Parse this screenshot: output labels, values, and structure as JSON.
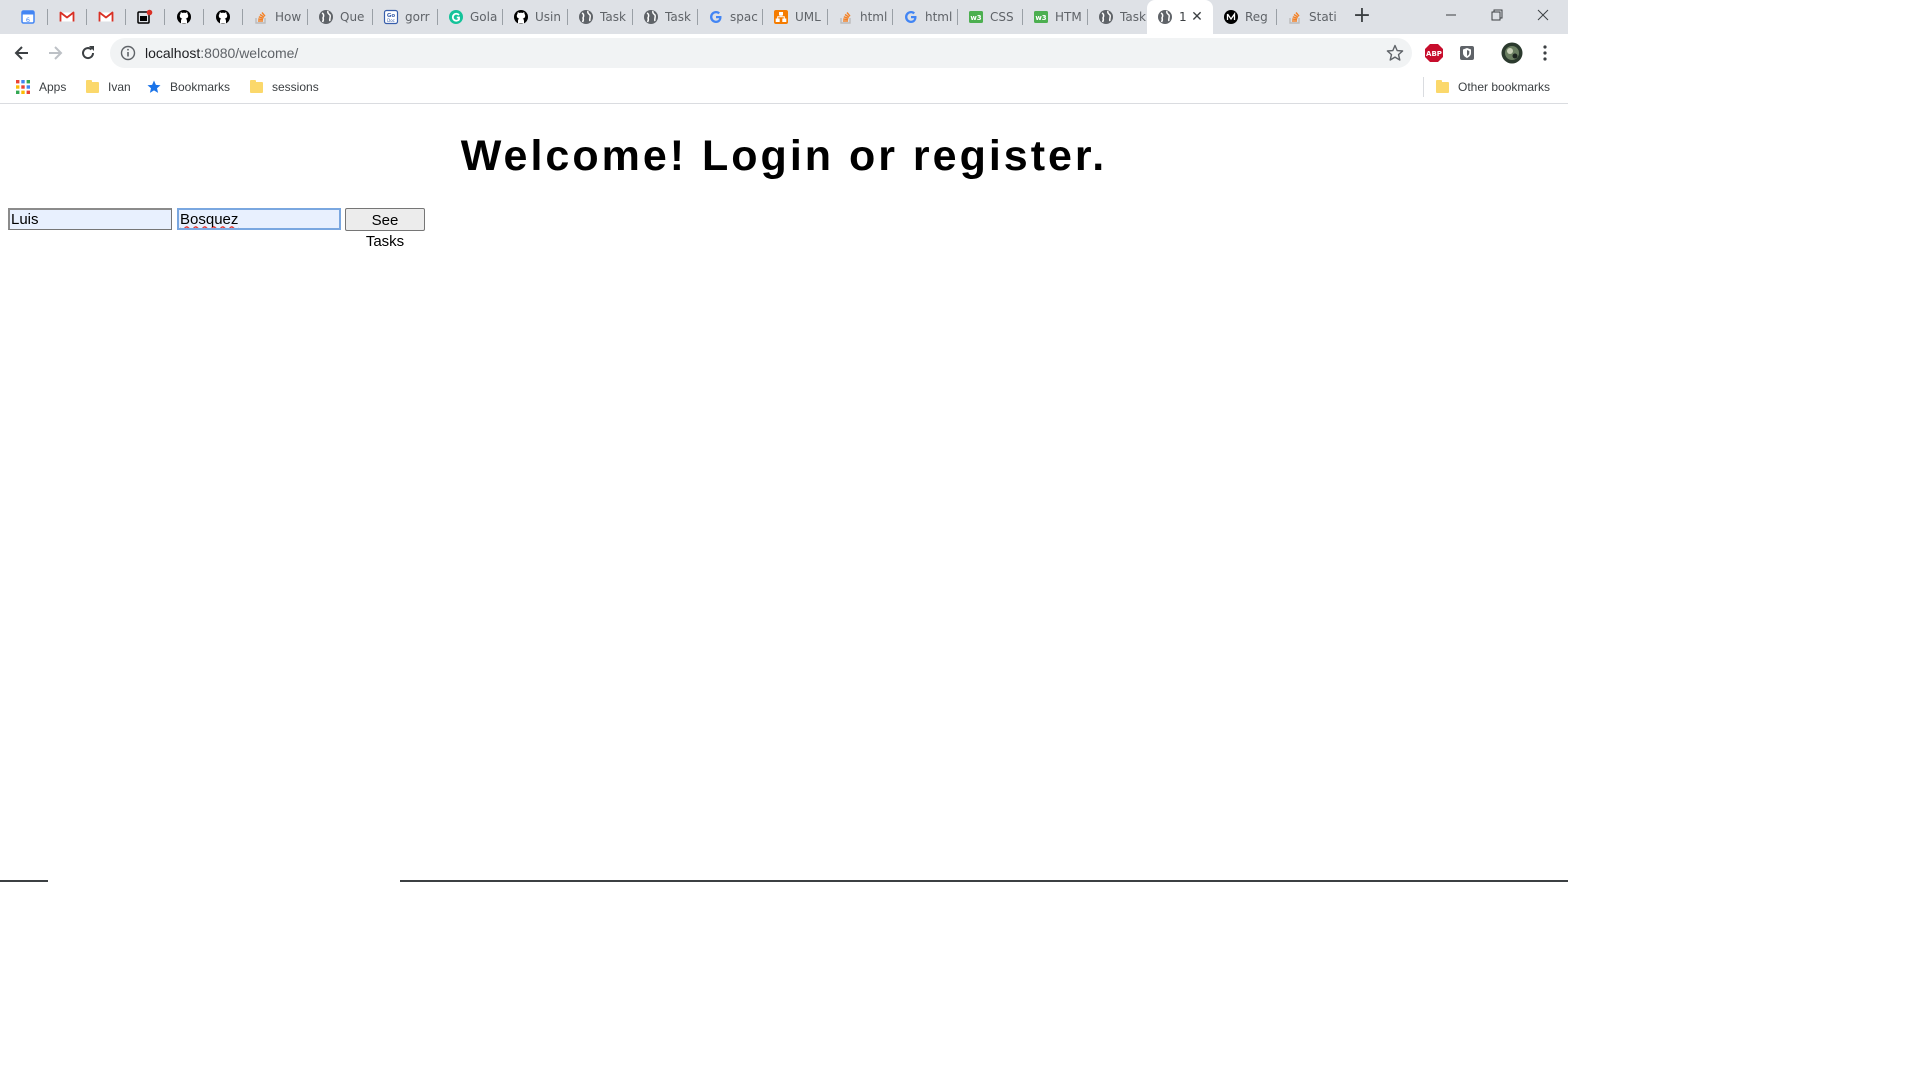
{
  "browser": {
    "tabs": [
      {
        "label": "",
        "icon": "google-calendar-icon",
        "icon_color": "#4285f4"
      },
      {
        "label": "",
        "icon": "gmail-icon",
        "icon_color": "#d93025"
      },
      {
        "label": "",
        "icon": "gmail-icon",
        "icon_color": "#d93025"
      },
      {
        "label": "",
        "icon": "notification-badge-icon",
        "icon_color": "#000000"
      },
      {
        "label": "",
        "icon": "github-icon",
        "icon_color": "#000000"
      },
      {
        "label": "",
        "icon": "github-icon",
        "icon_color": "#000000"
      },
      {
        "label": "How",
        "icon": "stackoverflow-icon",
        "icon_color": "#f48024"
      },
      {
        "label": "Que",
        "icon": "globe-icon",
        "icon_color": "#5f6368"
      },
      {
        "label": "gorr",
        "icon": "godoc-icon",
        "icon_color": "#375eab"
      },
      {
        "label": "Gola",
        "icon": "grammarly-icon",
        "icon_color": "#15c39a"
      },
      {
        "label": "Usin",
        "icon": "github-icon",
        "icon_color": "#000000"
      },
      {
        "label": "Task",
        "icon": "globe-icon",
        "icon_color": "#5f6368"
      },
      {
        "label": "Task",
        "icon": "globe-icon",
        "icon_color": "#5f6368"
      },
      {
        "label": "spac",
        "icon": "google-icon",
        "icon_color": "#4285f4"
      },
      {
        "label": "UML",
        "icon": "uml-icon",
        "icon_color": "#f57c00"
      },
      {
        "label": "html",
        "icon": "stackoverflow-icon",
        "icon_color": "#f48024"
      },
      {
        "label": "html",
        "icon": "google-icon",
        "icon_color": "#4285f4"
      },
      {
        "label": "CSS",
        "icon": "w3schools-icon",
        "icon_color": "#4caf50"
      },
      {
        "label": "HTM",
        "icon": "w3schools-icon",
        "icon_color": "#4caf50"
      },
      {
        "label": "Task",
        "icon": "globe-icon",
        "icon_color": "#5f6368"
      },
      {
        "label": "1",
        "icon": "globe-icon",
        "icon_color": "#5f6368",
        "active": true
      },
      {
        "label": "Reg",
        "icon": "medium-icon",
        "icon_color": "#000000"
      },
      {
        "label": "Stati",
        "icon": "stackoverflow-icon",
        "icon_color": "#f48024"
      }
    ],
    "new_tab_label": "+",
    "close_tab_glyph": "✕",
    "url_host": "localhost",
    "url_path": ":8080/welcome/",
    "bookmarks": [
      {
        "label": "Apps",
        "icon": "apps-grid-icon"
      },
      {
        "label": "Ivan",
        "icon": "folder-icon"
      },
      {
        "label": "Bookmarks",
        "icon": "star-icon"
      },
      {
        "label": "sessions",
        "icon": "folder-icon"
      }
    ],
    "other_bookmarks": "Other bookmarks",
    "extensions": [
      {
        "name": "adblock-plus-icon",
        "text": "ABP",
        "color": "#c70d2c"
      },
      {
        "name": "extension-shield-icon",
        "color": "#5f6368"
      }
    ]
  },
  "page": {
    "heading": "Welcome! Login or register.",
    "first_name_value": "Luis",
    "last_name_value": "Bosquez",
    "submit_label": "See Tasks"
  }
}
